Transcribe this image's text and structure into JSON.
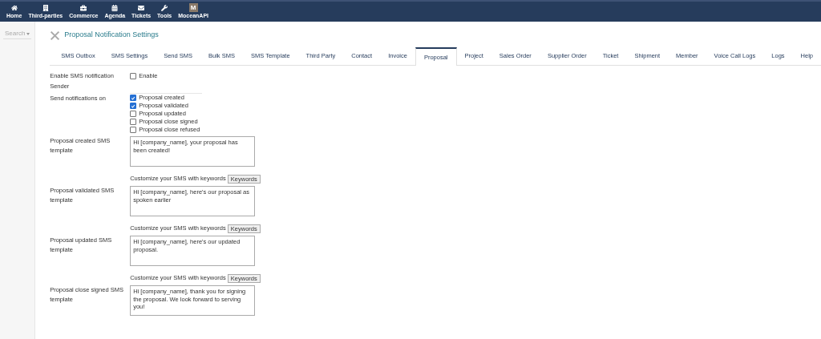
{
  "nav": [
    {
      "label": "Home"
    },
    {
      "label": "Third-parties"
    },
    {
      "label": "Commerce"
    },
    {
      "label": "Agenda"
    },
    {
      "label": "Tickets"
    },
    {
      "label": "Tools"
    },
    {
      "label": "MoceanAPI",
      "badge": "M"
    }
  ],
  "sidebar": {
    "search_placeholder": "Search"
  },
  "page_title": "Proposal Notification Settings",
  "tabs": [
    {
      "label": "SMS Outbox",
      "selected": false
    },
    {
      "label": "SMS Settings",
      "selected": false
    },
    {
      "label": "Send SMS",
      "selected": false
    },
    {
      "label": "Bulk SMS",
      "selected": false
    },
    {
      "label": "SMS Template",
      "selected": false
    },
    {
      "label": "Third Party",
      "selected": false
    },
    {
      "label": "Contact",
      "selected": false
    },
    {
      "label": "Invoice",
      "selected": false
    },
    {
      "label": "Proposal",
      "selected": true
    },
    {
      "label": "Project",
      "selected": false
    },
    {
      "label": "Sales Order",
      "selected": false
    },
    {
      "label": "Supplier Order",
      "selected": false
    },
    {
      "label": "Ticket",
      "selected": false
    },
    {
      "label": "Shipment",
      "selected": false
    },
    {
      "label": "Member",
      "selected": false
    },
    {
      "label": "Voice Call Logs",
      "selected": false
    },
    {
      "label": "Logs",
      "selected": false
    },
    {
      "label": "Help",
      "selected": false
    }
  ],
  "form": [
    {
      "kind": "checkbox",
      "label": "Enable SMS notification",
      "option": "Enable",
      "checked": false
    },
    {
      "kind": "text",
      "label": "Sender"
    },
    {
      "kind": "checklist",
      "label": "Send notifications on",
      "options": [
        {
          "label": "Proposal created",
          "checked": true
        },
        {
          "label": "Proposal validated",
          "checked": true
        },
        {
          "label": "Proposal updated",
          "checked": false
        },
        {
          "label": "Proposal close signed",
          "checked": false
        },
        {
          "label": "Proposal close refused",
          "checked": false
        }
      ]
    },
    {
      "kind": "template",
      "label": "Proposal created SMS template",
      "value": "Hi [company_name], your proposal has been created!",
      "hint": "Customize your SMS with keywords",
      "button": "Keywords"
    },
    {
      "kind": "template",
      "label": "Proposal validated SMS template",
      "value": "Hi [company_name], here's our proposal as spoken earlier",
      "hint": "Customize your SMS with keywords",
      "button": "Keywords"
    },
    {
      "kind": "template",
      "label": "Proposal updated SMS template",
      "value": "Hi [company_name], here's our updated proposal.",
      "hint": "Customize your SMS with keywords",
      "button": "Keywords"
    },
    {
      "kind": "template",
      "label": "Proposal close signed SMS template",
      "value": "Hi [company_name], thank you for signing the proposal. We look forward to serving you!"
    }
  ]
}
